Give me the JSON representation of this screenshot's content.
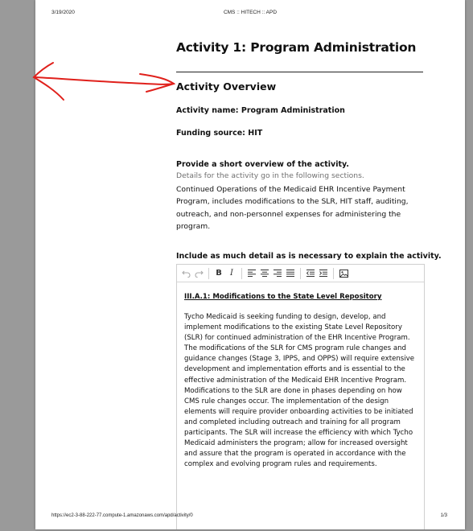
{
  "header": {
    "date": "3/19/2020",
    "center": "CMS :: HITECH :: APD"
  },
  "footer": {
    "url": "https://ec2-3-88-222-77.compute-1.amazonaws.com/apd/activity/0",
    "page": "1/3"
  },
  "activity": {
    "title": "Activity 1: Program Administration",
    "section_title": "Activity Overview",
    "name_line": "Activity name: Program Administration",
    "funding_line": "Funding source: HIT"
  },
  "overview": {
    "question": "Provide a short overview of the activity.",
    "hint": "Details for the activity go in the following sections.",
    "answer": "Continued Operations of the Medicaid EHR Incentive Payment Program, includes modifications to the SLR, HIT staff, auditing, outreach, and non-personnel expenses for administering the program."
  },
  "detail": {
    "question": "Include as much detail as is necessary to explain the activity.",
    "editor_heading": "III.A.1: Modifications to the State Level Repository",
    "editor_body": "Tycho Medicaid is seeking funding to design, develop, and implement modifications to the existing State Level Repository (SLR) for continued administration of the EHR Incentive Program. The modifications of the SLR for CMS program rule changes and guidance changes (Stage 3, IPPS, and OPPS) will require extensive development and implementation efforts and is essential to the effective administration of the Medicaid EHR Incentive Program. Modifications to the SLR are done in phases depending on how CMS rule changes occur. The implementation of the design elements will require provider onboarding activities to be initiated and completed including outreach and training for all program participants. The SLR will increase the efficiency with which Tycho Medicaid administers the program; allow for increased oversight and assure that the program is operated in accordance with the complex and evolving program rules and requirements."
  },
  "toolbar_icons": [
    "undo-icon",
    "redo-icon",
    "bold-icon",
    "italic-icon",
    "align-left-icon",
    "align-center-icon",
    "align-right-icon",
    "align-justify-icon",
    "outdent-icon",
    "indent-icon",
    "image-icon"
  ],
  "colors": {
    "annotation": "#e0201b",
    "hint": "#707070"
  }
}
